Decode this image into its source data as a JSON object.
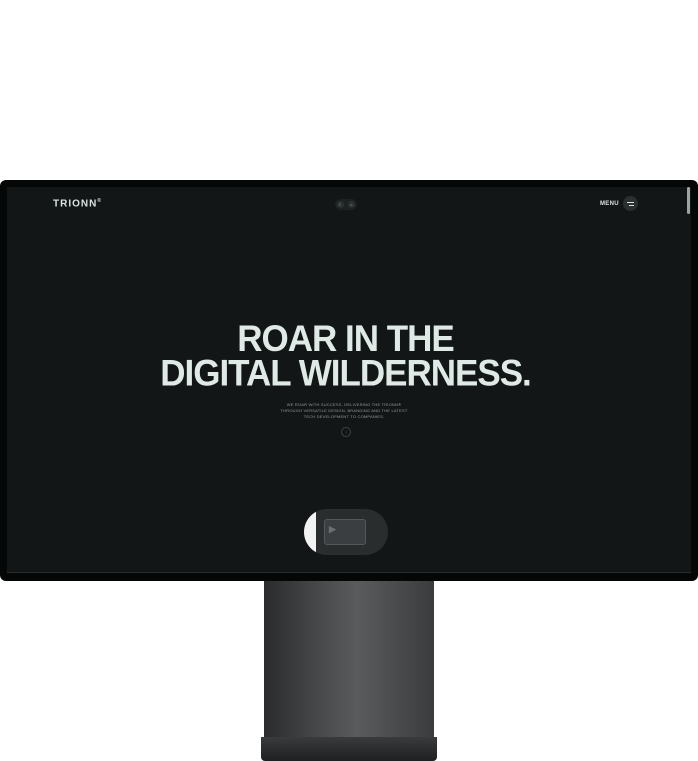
{
  "site": {
    "logo": "TRIONN",
    "logo_mark": "®",
    "menu_label": "MENU",
    "theme_toggle": {
      "dark_icon": "moon-icon",
      "light_icon": "sun-icon"
    },
    "hero": {
      "line1": "ROAR IN THE",
      "line2": "DIGITAL WILDERNESS.",
      "subtext_line1": "WE ROAR WITH SUCCESS, DELIVERING THE TRIONN®",
      "subtext_line2": "THROUGH VERSATILE DESIGN, BRANDING AND THE LATEST",
      "subtext_line3": "TECH DEVELOPMENT TO COMPANIES.",
      "scroll_icon": "arrow-down-icon"
    },
    "showreel": {
      "label": "play"
    }
  },
  "colors": {
    "background": "#131616",
    "text": "#dfe9e6",
    "bezel": "#050606"
  }
}
